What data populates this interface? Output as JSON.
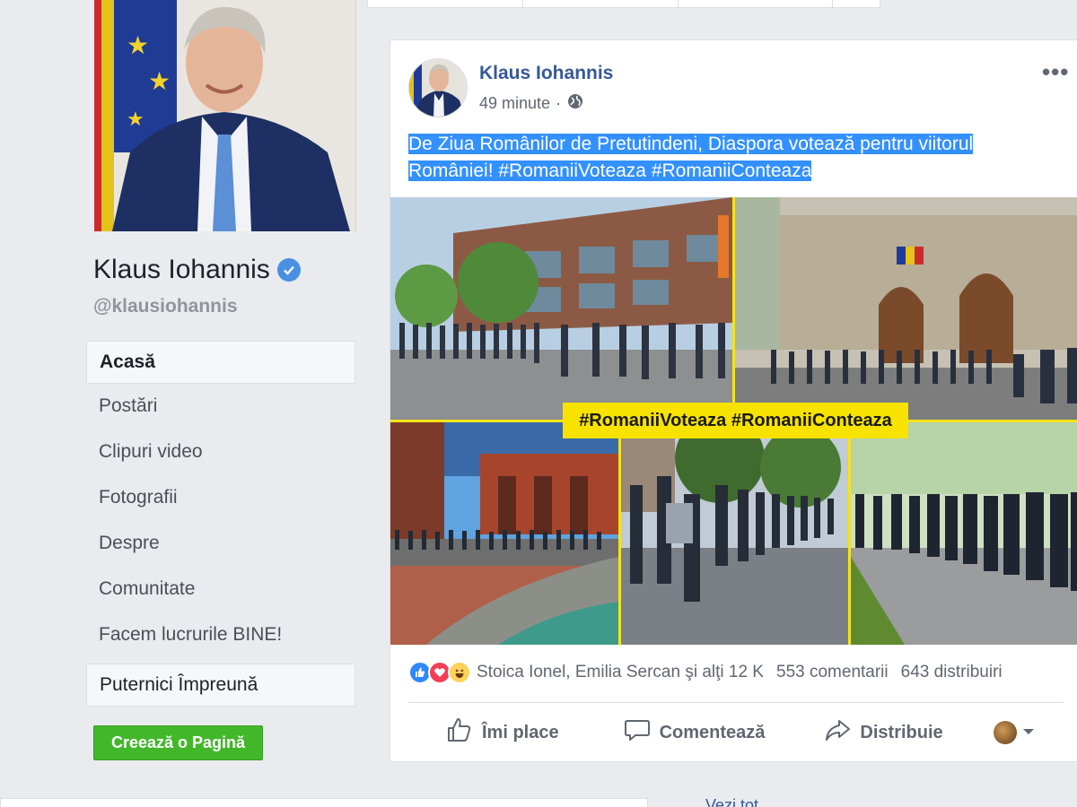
{
  "profile": {
    "name": "Klaus Iohannis",
    "handle": "@klausiohannis"
  },
  "nav": {
    "items": [
      {
        "label": "Acasă"
      },
      {
        "label": "Postări"
      },
      {
        "label": "Clipuri video"
      },
      {
        "label": "Fotografii"
      },
      {
        "label": "Despre"
      },
      {
        "label": "Comunitate"
      },
      {
        "label": "Facem lucrurile BINE!"
      },
      {
        "label": "Puternici Împreună"
      }
    ],
    "create_page_label": "Creează o Pagină"
  },
  "post": {
    "author": "Klaus Iohannis",
    "time": "49 minute",
    "separator": "·",
    "text_line1": "De Ziua Românilor de Pretutindeni, Diaspora votează pentru viitorul",
    "text_line2": "României! #RomaniiVoteaza #RomaniiConteaza",
    "hashtag_banner": "#RomaniiVoteaza #RomaniiConteaza",
    "reactions_names": "Stoica Ionel, Emilia Sercan şi alţi 12 K",
    "comments": "553 comentarii",
    "shares": "643 distribuiri",
    "actions": {
      "like": "Îmi place",
      "comment": "Comentează",
      "share": "Distribuie"
    }
  },
  "colors": {
    "link_blue": "#365899",
    "selection_blue": "#3390ff",
    "create_green": "#42b72a",
    "banner_yellow": "#f7e200"
  },
  "bottom": {
    "see_all": "Vezi tot"
  }
}
